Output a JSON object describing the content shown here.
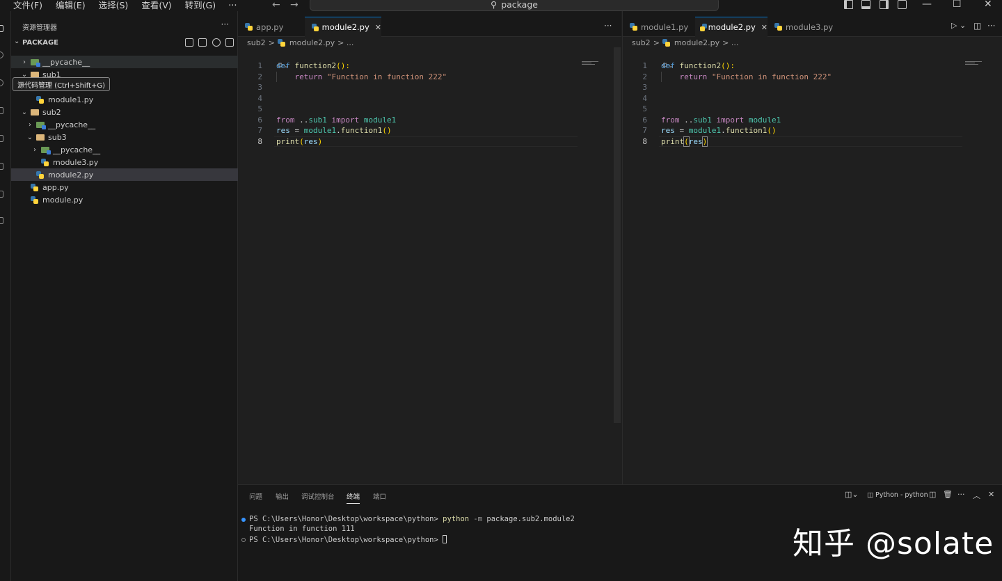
{
  "menu": [
    "文件(F)",
    "编辑(E)",
    "选择(S)",
    "查看(V)",
    "转到(G)",
    "···"
  ],
  "search": {
    "label": "package"
  },
  "sidebar": {
    "title": "资源管理器",
    "section": "PACKAGE",
    "tooltip": "源代码管理 (Ctrl+Shift+G)",
    "tree": [
      {
        "label": "__pycache__",
        "kind": "pycache",
        "twisty": "›",
        "depth": 1
      },
      {
        "label": "sub1",
        "kind": "folder",
        "twisty": "⌄",
        "depth": 1
      },
      {
        "label": "module1.py",
        "kind": "py",
        "twisty": "",
        "depth": 2
      },
      {
        "label": "sub2",
        "kind": "folder",
        "twisty": "⌄",
        "depth": 1
      },
      {
        "label": "__pycache__",
        "kind": "pycache",
        "twisty": "›",
        "depth": 2
      },
      {
        "label": "sub3",
        "kind": "folder",
        "twisty": "⌄",
        "depth": 2
      },
      {
        "label": "__pycache__",
        "kind": "pycache",
        "twisty": "›",
        "depth": 3
      },
      {
        "label": "module3.py",
        "kind": "py",
        "twisty": "",
        "depth": 3
      },
      {
        "label": "module2.py",
        "kind": "py",
        "twisty": "",
        "depth": 2
      },
      {
        "label": "app.py",
        "kind": "py",
        "twisty": "",
        "depth": 1
      },
      {
        "label": "module.py",
        "kind": "py",
        "twisty": "",
        "depth": 1
      }
    ]
  },
  "left_editor": {
    "tabs": [
      {
        "label": "app.py",
        "active": false
      },
      {
        "label": "module2.py",
        "active": true,
        "close": "✕"
      }
    ],
    "breadcrumb": {
      "folder": "sub2",
      "sep": ">",
      "file": "module2.py",
      "tail": "> ..."
    }
  },
  "right_editor": {
    "tabs": [
      {
        "label": "module1.py",
        "active": false
      },
      {
        "label": "module2.py",
        "active": true,
        "close": "✕"
      },
      {
        "label": "module3.py",
        "active": false
      }
    ],
    "breadcrumb": {
      "folder": "sub2",
      "sep": ">",
      "file": "module2.py",
      "tail": "> ..."
    }
  },
  "code": {
    "line_numbers": [
      "1",
      "2",
      "3",
      "4",
      "5",
      "6",
      "7",
      "8"
    ],
    "l1": {
      "kw": "def",
      "fn": "function2",
      "rest": "():"
    },
    "l2": {
      "kw": "return",
      "str": "\"Function in function 222\""
    },
    "l6": {
      "kw1": "from",
      "mid": " ..",
      "mod": "sub1",
      "kw2": "import",
      "mod2": "module1"
    },
    "l7": {
      "var": "res",
      "eq": " = ",
      "mod": "module1",
      "dot": ".",
      "fn": "function1",
      "paren": "()"
    },
    "l8": {
      "fn": "print",
      "open": "(",
      "var": "res",
      "close": ")"
    }
  },
  "panel": {
    "tabs": [
      "问题",
      "输出",
      "调试控制台",
      "终端",
      "端口"
    ],
    "active_tab": "终端",
    "terminal_name": "Python - python",
    "lines": {
      "prompt1": "PS C:\\Users\\Honor\\Desktop\\workspace\\python> ",
      "cmd": "python",
      "flag": " -m ",
      "arg": "package.sub2.module2",
      "output": "Function in function 111",
      "prompt2": "PS C:\\Users\\Honor\\Desktop\\workspace\\python> "
    }
  },
  "watermark": "知乎 @solate",
  "colors": {
    "accent": "#0078d4",
    "folder": "#dcb67a",
    "keyword": "#569cd6",
    "string": "#ce9178",
    "function": "#dcdcaa"
  }
}
